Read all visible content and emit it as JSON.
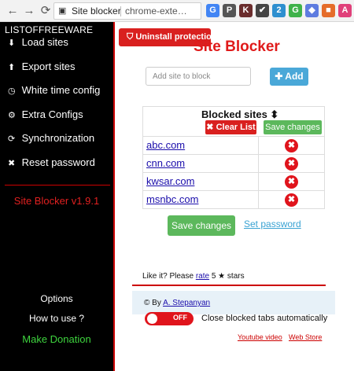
{
  "browser": {
    "back_icon": "←",
    "forward_icon": "→",
    "reload_icon": "⟳",
    "tab_title": "Site blocker",
    "url": "chrome-exte…",
    "star_icon": "☆",
    "extensions": [
      {
        "label": "G",
        "color": "#4285f4"
      },
      {
        "label": "P",
        "color": "#555555"
      },
      {
        "label": "K",
        "color": "#6b2d2d"
      },
      {
        "label": "✔",
        "color": "#444444"
      },
      {
        "label": "2",
        "color": "#2e8fcf"
      },
      {
        "label": "G",
        "color": "#3fb24a"
      },
      {
        "label": "◆",
        "color": "#5e7ce0"
      },
      {
        "label": "■",
        "color": "#e56c2a"
      },
      {
        "label": "A",
        "color": "#e0407a"
      }
    ]
  },
  "sidebar": {
    "brand": "LISTOFFREEWARE",
    "items": [
      {
        "icon": "⬇",
        "label": "Load sites"
      },
      {
        "icon": "⬆",
        "label": "Export sites"
      },
      {
        "icon": "◷",
        "label": "White time config"
      },
      {
        "icon": "⚙",
        "label": "Extra Configs"
      },
      {
        "icon": "⟳",
        "label": "Synchronization"
      },
      {
        "icon": "✖",
        "label": "Reset password"
      }
    ],
    "version": "Site Blocker v1.9.1",
    "options": "Options",
    "how_to_use": "How to use ?",
    "donation": "Make Donation"
  },
  "main": {
    "uninstall_icon": "⛉",
    "uninstall_label": "Uninstall protection",
    "title": "Site Blocker",
    "input_placeholder": "Add site to block",
    "add_label": "✚ Add",
    "table_title": "Blocked sites ⬍",
    "clear_label": "✖ Clear List",
    "save_small_label": "Save changes",
    "sites": [
      "abc.com",
      "cnn.com",
      "kwsar.com",
      "msnbc.com"
    ],
    "remove_icon": "✖",
    "save_big_label": "Save changes",
    "set_password": "Set password",
    "rate_prefix": "Like it? Please",
    "rate_link": "rate",
    "rate_suffix": "5 ★ stars",
    "by_prefix": "© By",
    "author": "A. Stepanyan",
    "toggle_state": "OFF",
    "close_label": "Close blocked tabs automatically",
    "youtube": "Youtube video",
    "webstore": "Web Store"
  }
}
